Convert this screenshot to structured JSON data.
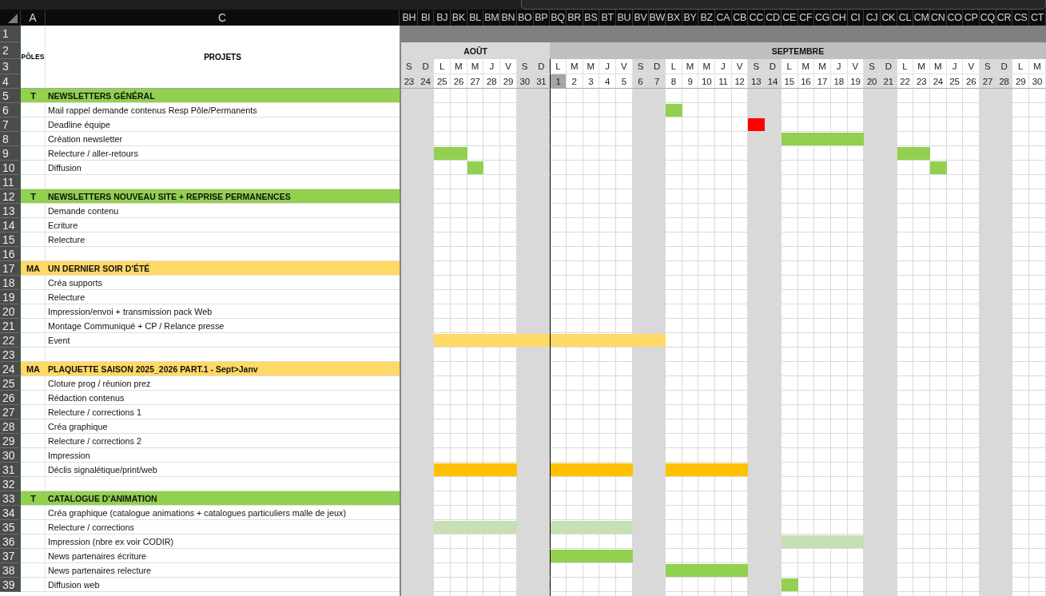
{
  "sheet": {
    "column_letters": [
      "A",
      "C"
    ],
    "header_row_numbers": [
      "1",
      "2",
      "3",
      "4"
    ],
    "header": {
      "poles": "PÔLES",
      "projets": "PROJETS"
    },
    "months": [
      {
        "label": "AOÛT",
        "color": "#d9d9d9",
        "days": [
          {
            "column": "BH",
            "weekday": "S",
            "day": "23",
            "weekend": true,
            "today": false
          },
          {
            "column": "BI",
            "weekday": "D",
            "day": "24",
            "weekend": true,
            "today": false
          },
          {
            "column": "BJ",
            "weekday": "L",
            "day": "25",
            "weekend": false,
            "today": false
          },
          {
            "column": "BK",
            "weekday": "M",
            "day": "26",
            "weekend": false,
            "today": false
          },
          {
            "column": "BL",
            "weekday": "M",
            "day": "27",
            "weekend": false,
            "today": false
          },
          {
            "column": "BM",
            "weekday": "J",
            "day": "28",
            "weekend": false,
            "today": false
          },
          {
            "column": "BN",
            "weekday": "V",
            "day": "29",
            "weekend": false,
            "today": false
          },
          {
            "column": "BO",
            "weekday": "S",
            "day": "30",
            "weekend": true,
            "today": false
          },
          {
            "column": "BP",
            "weekday": "D",
            "day": "31",
            "weekend": true,
            "today": false
          }
        ]
      },
      {
        "label": "SEPTEMBRE",
        "color": "#bfbfbf",
        "days": [
          {
            "column": "BQ",
            "weekday": "L",
            "day": "1",
            "weekend": false,
            "today": true
          },
          {
            "column": "BR",
            "weekday": "M",
            "day": "2",
            "weekend": false,
            "today": false
          },
          {
            "column": "BS",
            "weekday": "M",
            "day": "3",
            "weekend": false,
            "today": false
          },
          {
            "column": "BT",
            "weekday": "J",
            "day": "4",
            "weekend": false,
            "today": false
          },
          {
            "column": "BU",
            "weekday": "V",
            "day": "5",
            "weekend": false,
            "today": false
          },
          {
            "column": "BV",
            "weekday": "S",
            "day": "6",
            "weekend": true,
            "today": false
          },
          {
            "column": "BW",
            "weekday": "D",
            "day": "7",
            "weekend": true,
            "today": false
          },
          {
            "column": "BX",
            "weekday": "L",
            "day": "8",
            "weekend": false,
            "today": false
          },
          {
            "column": "BY",
            "weekday": "M",
            "day": "9",
            "weekend": false,
            "today": false
          },
          {
            "column": "BZ",
            "weekday": "M",
            "day": "10",
            "weekend": false,
            "today": false
          },
          {
            "column": "CA",
            "weekday": "J",
            "day": "11",
            "weekend": false,
            "today": false
          },
          {
            "column": "CB",
            "weekday": "V",
            "day": "12",
            "weekend": false,
            "today": false
          },
          {
            "column": "CC",
            "weekday": "S",
            "day": "13",
            "weekend": true,
            "today": false
          },
          {
            "column": "CD",
            "weekday": "D",
            "day": "14",
            "weekend": true,
            "today": false
          },
          {
            "column": "CE",
            "weekday": "L",
            "day": "15",
            "weekend": false,
            "today": false
          },
          {
            "column": "CF",
            "weekday": "M",
            "day": "16",
            "weekend": false,
            "today": false
          },
          {
            "column": "CG",
            "weekday": "M",
            "day": "17",
            "weekend": false,
            "today": false
          },
          {
            "column": "CH",
            "weekday": "J",
            "day": "18",
            "weekend": false,
            "today": false
          },
          {
            "column": "CI",
            "weekday": "V",
            "day": "19",
            "weekend": false,
            "today": false
          },
          {
            "column": "CJ",
            "weekday": "S",
            "day": "20",
            "weekend": true,
            "today": false
          },
          {
            "column": "CK",
            "weekday": "D",
            "day": "21",
            "weekend": true,
            "today": false
          },
          {
            "column": "CL",
            "weekday": "L",
            "day": "22",
            "weekend": false,
            "today": false
          },
          {
            "column": "CM",
            "weekday": "M",
            "day": "23",
            "weekend": false,
            "today": false
          },
          {
            "column": "CN",
            "weekday": "M",
            "day": "24",
            "weekend": false,
            "today": false
          },
          {
            "column": "CO",
            "weekday": "J",
            "day": "25",
            "weekend": false,
            "today": false
          },
          {
            "column": "CP",
            "weekday": "V",
            "day": "26",
            "weekend": false,
            "today": false
          },
          {
            "column": "CQ",
            "weekday": "S",
            "day": "27",
            "weekend": true,
            "today": false
          },
          {
            "column": "CR",
            "weekday": "D",
            "day": "28",
            "weekend": true,
            "today": false
          },
          {
            "column": "CS",
            "weekday": "L",
            "day": "29",
            "weekend": false,
            "today": false
          },
          {
            "column": "CT",
            "weekday": "M",
            "day": "30",
            "weekend": false,
            "today": false
          }
        ]
      }
    ],
    "rows": [
      {
        "number": "5",
        "kind": "section",
        "pole": "T",
        "label": "NEWSLETTERS GÉNÉRAL",
        "color": "#92d050"
      },
      {
        "number": "6",
        "kind": "task",
        "label": "Mail rappel demande contenus Resp Pôle/Permanents",
        "timeline": [
          {
            "filled": false
          },
          {
            "filled": false
          },
          {
            "filled": false
          },
          {
            "filled": false
          },
          {
            "filled": false
          },
          {
            "filled": false
          },
          {
            "filled": false
          },
          {
            "filled": false
          },
          {
            "filled": false
          },
          {
            "filled": false
          },
          {
            "filled": false
          },
          {
            "filled": false
          },
          {
            "filled": false
          },
          {
            "filled": false
          },
          {
            "filled": false
          },
          {
            "filled": false
          },
          {
            "filled": true,
            "color": "#92d050"
          }
        ]
      },
      {
        "number": "7",
        "kind": "task",
        "label": "Deadline équipe",
        "timeline": [
          {
            "filled": false
          },
          {
            "filled": false
          },
          {
            "filled": false
          },
          {
            "filled": false
          },
          {
            "filled": false
          },
          {
            "filled": false
          },
          {
            "filled": false
          },
          {
            "filled": false
          },
          {
            "filled": false
          },
          {
            "filled": false
          },
          {
            "filled": false
          },
          {
            "filled": false
          },
          {
            "filled": false
          },
          {
            "filled": false
          },
          {
            "filled": false
          },
          {
            "filled": false
          },
          {
            "filled": false
          },
          {
            "filled": false
          },
          {
            "filled": false
          },
          {
            "filled": false
          },
          {
            "filled": false
          },
          {
            "filled": true,
            "color": "#ff0000"
          }
        ]
      },
      {
        "number": "8",
        "kind": "task",
        "label": "Création newsletter",
        "timeline": [
          {
            "filled": false
          },
          {
            "filled": false
          },
          {
            "filled": false
          },
          {
            "filled": false
          },
          {
            "filled": false
          },
          {
            "filled": false
          },
          {
            "filled": false
          },
          {
            "filled": false
          },
          {
            "filled": false
          },
          {
            "filled": false
          },
          {
            "filled": false
          },
          {
            "filled": false
          },
          {
            "filled": false
          },
          {
            "filled": false
          },
          {
            "filled": false
          },
          {
            "filled": false
          },
          {
            "filled": false
          },
          {
            "filled": false
          },
          {
            "filled": false
          },
          {
            "filled": false
          },
          {
            "filled": false
          },
          {
            "filled": false
          },
          {
            "filled": false
          },
          {
            "filled": true,
            "color": "#92d050"
          },
          {
            "filled": true,
            "color": "#92d050"
          },
          {
            "filled": true,
            "color": "#92d050"
          },
          {
            "filled": true,
            "color": "#92d050"
          },
          {
            "filled": true,
            "color": "#92d050"
          }
        ]
      },
      {
        "number": "9",
        "kind": "task",
        "label": "Relecture / aller-retours",
        "timeline": [
          {
            "filled": false
          },
          {
            "filled": false
          },
          {
            "filled": true,
            "color": "#92d050"
          },
          {
            "filled": true,
            "color": "#92d050"
          },
          {
            "filled": false
          },
          {
            "filled": false
          },
          {
            "filled": false
          },
          {
            "filled": false
          },
          {
            "filled": false
          },
          {
            "filled": false
          },
          {
            "filled": false
          },
          {
            "filled": false
          },
          {
            "filled": false
          },
          {
            "filled": false
          },
          {
            "filled": false
          },
          {
            "filled": false
          },
          {
            "filled": false
          },
          {
            "filled": false
          },
          {
            "filled": false
          },
          {
            "filled": false
          },
          {
            "filled": false
          },
          {
            "filled": false
          },
          {
            "filled": false
          },
          {
            "filled": false
          },
          {
            "filled": false
          },
          {
            "filled": false
          },
          {
            "filled": false
          },
          {
            "filled": false
          },
          {
            "filled": false
          },
          {
            "filled": false
          },
          {
            "filled": true,
            "color": "#92d050"
          },
          {
            "filled": true,
            "color": "#92d050"
          }
        ]
      },
      {
        "number": "10",
        "kind": "task",
        "label": "Diffusion",
        "timeline": [
          {
            "filled": false
          },
          {
            "filled": false
          },
          {
            "filled": false
          },
          {
            "filled": false
          },
          {
            "filled": true,
            "color": "#92d050"
          },
          {
            "filled": false
          },
          {
            "filled": false
          },
          {
            "filled": false
          },
          {
            "filled": false
          },
          {
            "filled": false
          },
          {
            "filled": false
          },
          {
            "filled": false
          },
          {
            "filled": false
          },
          {
            "filled": false
          },
          {
            "filled": false
          },
          {
            "filled": false
          },
          {
            "filled": false
          },
          {
            "filled": false
          },
          {
            "filled": false
          },
          {
            "filled": false
          },
          {
            "filled": false
          },
          {
            "filled": false
          },
          {
            "filled": false
          },
          {
            "filled": false
          },
          {
            "filled": false
          },
          {
            "filled": false
          },
          {
            "filled": false
          },
          {
            "filled": false
          },
          {
            "filled": false
          },
          {
            "filled": false
          },
          {
            "filled": false
          },
          {
            "filled": false
          },
          {
            "filled": true,
            "color": "#92d050"
          }
        ]
      },
      {
        "number": "11",
        "kind": "blank"
      },
      {
        "number": "12",
        "kind": "section",
        "pole": "T",
        "label": "NEWSLETTERS NOUVEAU SITE + REPRISE PERMANENCES",
        "color": "#92d050"
      },
      {
        "number": "13",
        "kind": "task",
        "label": "Demande contenu"
      },
      {
        "number": "14",
        "kind": "task",
        "label": "Ecriture"
      },
      {
        "number": "15",
        "kind": "task",
        "label": "Relecture"
      },
      {
        "number": "16",
        "kind": "blank"
      },
      {
        "number": "17",
        "kind": "section",
        "pole": "MA",
        "label": "UN DERNIER SOIR D'ÉTÉ",
        "color": "#ffd966"
      },
      {
        "number": "18",
        "kind": "task",
        "label": "Créa supports"
      },
      {
        "number": "19",
        "kind": "task",
        "label": "Relecture"
      },
      {
        "number": "20",
        "kind": "task",
        "label": "Impression/envoi + transmission pack Web"
      },
      {
        "number": "21",
        "kind": "task",
        "label": "Montage Communiqué + CP / Relance presse"
      },
      {
        "number": "22",
        "kind": "task",
        "label": "Event",
        "timeline": [
          {
            "filled": false
          },
          {
            "filled": false
          },
          {
            "filled": true,
            "color": "#ffd966"
          },
          {
            "filled": true,
            "color": "#ffd966"
          },
          {
            "filled": true,
            "color": "#ffd966"
          },
          {
            "filled": true,
            "color": "#ffd966"
          },
          {
            "filled": true,
            "color": "#ffd966"
          },
          {
            "filled": true,
            "color": "#ffd966"
          },
          {
            "filled": true,
            "color": "#ffd966"
          },
          {
            "filled": true,
            "color": "#ffd966"
          },
          {
            "filled": true,
            "color": "#ffd966"
          },
          {
            "filled": true,
            "color": "#ffd966"
          },
          {
            "filled": true,
            "color": "#ffd966"
          },
          {
            "filled": true,
            "color": "#ffd966"
          },
          {
            "filled": true,
            "color": "#ffd966"
          },
          {
            "filled": true,
            "color": "#ffd966"
          }
        ]
      },
      {
        "number": "23",
        "kind": "blank"
      },
      {
        "number": "24",
        "kind": "section",
        "pole": "MA",
        "label": "PLAQUETTE SAISON 2025_2026 PART.1 - Sept>Janv",
        "color": "#ffd966"
      },
      {
        "number": "25",
        "kind": "task",
        "label": "Cloture prog / réunion prez"
      },
      {
        "number": "26",
        "kind": "task",
        "label": "Rédaction contenus"
      },
      {
        "number": "27",
        "kind": "task",
        "label": "Relecture / corrections 1"
      },
      {
        "number": "28",
        "kind": "task",
        "label": "Créa graphique"
      },
      {
        "number": "29",
        "kind": "task",
        "label": "Relecture / corrections 2"
      },
      {
        "number": "30",
        "kind": "task",
        "label": "Impression"
      },
      {
        "number": "31",
        "kind": "task",
        "label": "Déclis signalétique/print/web",
        "timeline": [
          {
            "filled": false
          },
          {
            "filled": false
          },
          {
            "filled": true,
            "color": "#ffc000"
          },
          {
            "filled": true,
            "color": "#ffc000"
          },
          {
            "filled": true,
            "color": "#ffc000"
          },
          {
            "filled": true,
            "color": "#ffc000"
          },
          {
            "filled": true,
            "color": "#ffc000"
          },
          {
            "filled": false
          },
          {
            "filled": false
          },
          {
            "filled": true,
            "color": "#ffc000"
          },
          {
            "filled": true,
            "color": "#ffc000"
          },
          {
            "filled": true,
            "color": "#ffc000"
          },
          {
            "filled": true,
            "color": "#ffc000"
          },
          {
            "filled": true,
            "color": "#ffc000"
          },
          {
            "filled": false
          },
          {
            "filled": false
          },
          {
            "filled": true,
            "color": "#ffc000"
          },
          {
            "filled": true,
            "color": "#ffc000"
          },
          {
            "filled": true,
            "color": "#ffc000"
          },
          {
            "filled": true,
            "color": "#ffc000"
          },
          {
            "filled": true,
            "color": "#ffc000"
          }
        ]
      },
      {
        "number": "32",
        "kind": "blank"
      },
      {
        "number": "33",
        "kind": "section",
        "pole": "T",
        "label": "CATALOGUE D'ANIMATION",
        "color": "#92d050"
      },
      {
        "number": "34",
        "kind": "task",
        "label": "Créa graphique (catalogue animations + catalogues particuliers malle de jeux)"
      },
      {
        "number": "35",
        "kind": "task",
        "label": "Relecture / corrections",
        "timeline": [
          {
            "filled": false
          },
          {
            "filled": false
          },
          {
            "filled": true,
            "color": "#c6e0b4"
          },
          {
            "filled": true,
            "color": "#c6e0b4"
          },
          {
            "filled": true,
            "color": "#c6e0b4"
          },
          {
            "filled": true,
            "color": "#c6e0b4"
          },
          {
            "filled": true,
            "color": "#c6e0b4"
          },
          {
            "filled": false
          },
          {
            "filled": false
          },
          {
            "filled": true,
            "color": "#c6e0b4"
          },
          {
            "filled": true,
            "color": "#c6e0b4"
          },
          {
            "filled": true,
            "color": "#c6e0b4"
          },
          {
            "filled": true,
            "color": "#c6e0b4"
          },
          {
            "filled": true,
            "color": "#c6e0b4"
          }
        ]
      },
      {
        "number": "36",
        "kind": "task",
        "label": "Impression (nbre ex voir CODIR)",
        "timeline": [
          {
            "filled": false
          },
          {
            "filled": false
          },
          {
            "filled": false
          },
          {
            "filled": false
          },
          {
            "filled": false
          },
          {
            "filled": false
          },
          {
            "filled": false
          },
          {
            "filled": false
          },
          {
            "filled": false
          },
          {
            "filled": false
          },
          {
            "filled": false
          },
          {
            "filled": false
          },
          {
            "filled": false
          },
          {
            "filled": false
          },
          {
            "filled": false
          },
          {
            "filled": false
          },
          {
            "filled": false
          },
          {
            "filled": false
          },
          {
            "filled": false
          },
          {
            "filled": false
          },
          {
            "filled": false
          },
          {
            "filled": false
          },
          {
            "filled": false
          },
          {
            "filled": true,
            "color": "#c6e0b4"
          },
          {
            "filled": true,
            "color": "#c6e0b4"
          },
          {
            "filled": true,
            "color": "#c6e0b4"
          },
          {
            "filled": true,
            "color": "#c6e0b4"
          },
          {
            "filled": true,
            "color": "#c6e0b4"
          }
        ]
      },
      {
        "number": "37",
        "kind": "task",
        "label": "News partenaires écriture",
        "timeline": [
          {
            "filled": false
          },
          {
            "filled": false
          },
          {
            "filled": false
          },
          {
            "filled": false
          },
          {
            "filled": false
          },
          {
            "filled": false
          },
          {
            "filled": false
          },
          {
            "filled": false
          },
          {
            "filled": false
          },
          {
            "filled": true,
            "color": "#92d050"
          },
          {
            "filled": true,
            "color": "#92d050"
          },
          {
            "filled": true,
            "color": "#92d050"
          },
          {
            "filled": true,
            "color": "#92d050"
          },
          {
            "filled": true,
            "color": "#92d050"
          }
        ]
      },
      {
        "number": "38",
        "kind": "task",
        "label": "News partenaires relecture",
        "timeline": [
          {
            "filled": false
          },
          {
            "filled": false
          },
          {
            "filled": false
          },
          {
            "filled": false
          },
          {
            "filled": false
          },
          {
            "filled": false
          },
          {
            "filled": false
          },
          {
            "filled": false
          },
          {
            "filled": false
          },
          {
            "filled": false
          },
          {
            "filled": false
          },
          {
            "filled": false
          },
          {
            "filled": false
          },
          {
            "filled": false
          },
          {
            "filled": false
          },
          {
            "filled": false
          },
          {
            "filled": true,
            "color": "#92d050"
          },
          {
            "filled": true,
            "color": "#92d050"
          },
          {
            "filled": true,
            "color": "#92d050"
          },
          {
            "filled": true,
            "color": "#92d050"
          },
          {
            "filled": true,
            "color": "#92d050"
          }
        ]
      },
      {
        "number": "39",
        "kind": "task",
        "label": "Diffusion web",
        "timeline": [
          {
            "filled": false
          },
          {
            "filled": false
          },
          {
            "filled": false
          },
          {
            "filled": false
          },
          {
            "filled": false
          },
          {
            "filled": false
          },
          {
            "filled": false
          },
          {
            "filled": false
          },
          {
            "filled": false
          },
          {
            "filled": false
          },
          {
            "filled": false
          },
          {
            "filled": false
          },
          {
            "filled": false
          },
          {
            "filled": false
          },
          {
            "filled": false
          },
          {
            "filled": false
          },
          {
            "filled": false
          },
          {
            "filled": false
          },
          {
            "filled": false
          },
          {
            "filled": false
          },
          {
            "filled": false
          },
          {
            "filled": false
          },
          {
            "filled": false
          },
          {
            "filled": true,
            "color": "#92d050"
          }
        ]
      }
    ]
  }
}
